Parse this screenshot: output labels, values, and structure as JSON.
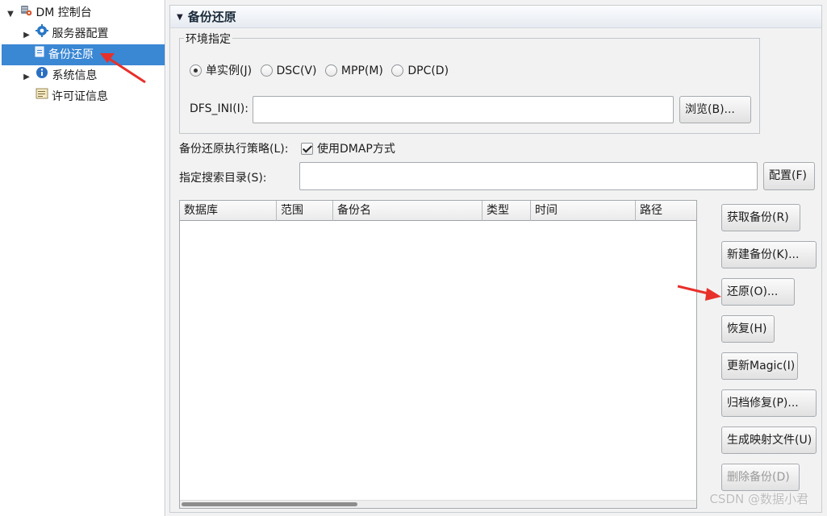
{
  "tree": {
    "root": {
      "label": "DM 控制台",
      "icon": "database-gear-icon"
    },
    "items": [
      {
        "label": "服务器配置",
        "icon": "gear-icon",
        "expandable": true,
        "selected": false
      },
      {
        "label": "备份还原",
        "icon": "backup-document-icon",
        "expandable": false,
        "selected": true
      },
      {
        "label": "系统信息",
        "icon": "info-icon",
        "expandable": true,
        "selected": false
      },
      {
        "label": "许可证信息",
        "icon": "license-document-icon",
        "expandable": false,
        "selected": false
      }
    ]
  },
  "section": {
    "title": "备份还原"
  },
  "environment": {
    "legend": "环境指定",
    "options": [
      {
        "label": "单实例(J)",
        "checked": true
      },
      {
        "label": "DSC(V)",
        "checked": false
      },
      {
        "label": "MPP(M)",
        "checked": false
      },
      {
        "label": "DPC(D)",
        "checked": false
      }
    ],
    "dfs_label": "DFS_INI(I):",
    "dfs_value": "",
    "browse_button": "浏览(B)..."
  },
  "strategy": {
    "label": "备份还原执行策略(L):",
    "dmap_label": "使用DMAP方式",
    "dmap_checked": true
  },
  "search_dir": {
    "label": "指定搜索目录(S):",
    "value": "",
    "config_button": "配置(F)"
  },
  "table": {
    "columns": [
      "数据库",
      "范围",
      "备份名",
      "类型",
      "时间",
      "路径"
    ],
    "rows": []
  },
  "actions": [
    {
      "label": "获取备份(R)",
      "enabled": true
    },
    {
      "label": "新建备份(K)...",
      "enabled": true
    },
    {
      "label": "还原(O)...",
      "enabled": true
    },
    {
      "label": "恢复(H)",
      "enabled": true
    },
    {
      "label": "更新Magic(I)",
      "enabled": true
    },
    {
      "label": "归档修复(P)...",
      "enabled": true
    },
    {
      "label": "生成映射文件(U)",
      "enabled": true
    },
    {
      "label": "删除备份(D)",
      "enabled": false
    }
  ],
  "watermark": "CSDN @数据小君",
  "colors": {
    "selection": "#3a87d4",
    "annotation_arrow": "#e8302a"
  }
}
